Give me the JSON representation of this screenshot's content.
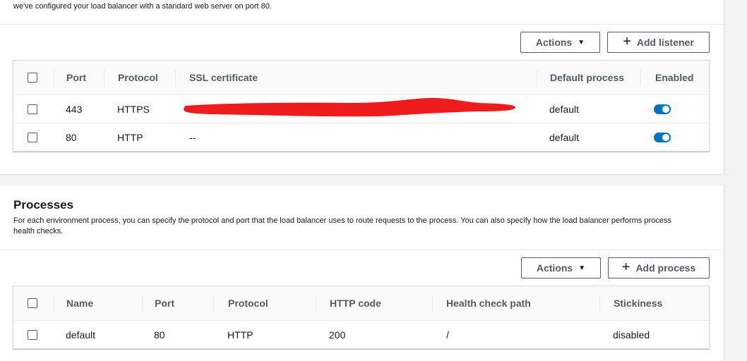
{
  "listeners": {
    "intro_text": "we've configured your load balancer with a standard web server on port 80.",
    "actions_label": "Actions",
    "add_label": "Add listener",
    "columns": [
      "Port",
      "Protocol",
      "SSL certificate",
      "Default process",
      "Enabled"
    ],
    "rows": [
      {
        "port": "443",
        "protocol": "HTTPS",
        "ssl": "",
        "default_process": "default",
        "enabled": true
      },
      {
        "port": "80",
        "protocol": "HTTP",
        "ssl": "--",
        "default_process": "default",
        "enabled": true
      }
    ]
  },
  "processes": {
    "title": "Processes",
    "description": "For each environment process, you can specify the protocol and port that the load balancer uses to route requests to the process. You can also specify how the load balancer performs process health checks.",
    "actions_label": "Actions",
    "add_label": "Add process",
    "columns": [
      "Name",
      "Port",
      "Protocol",
      "HTTP code",
      "Health check path",
      "Stickiness"
    ],
    "rows": [
      {
        "name": "default",
        "port": "80",
        "protocol": "HTTP",
        "http_code": "200",
        "health_check_path": "/",
        "stickiness": "disabled"
      }
    ]
  },
  "colors": {
    "accent": "#0073bb",
    "redaction": "#ee1c1c"
  },
  "icons": {
    "caret": "caret-down-icon",
    "plus": "plus-icon"
  }
}
